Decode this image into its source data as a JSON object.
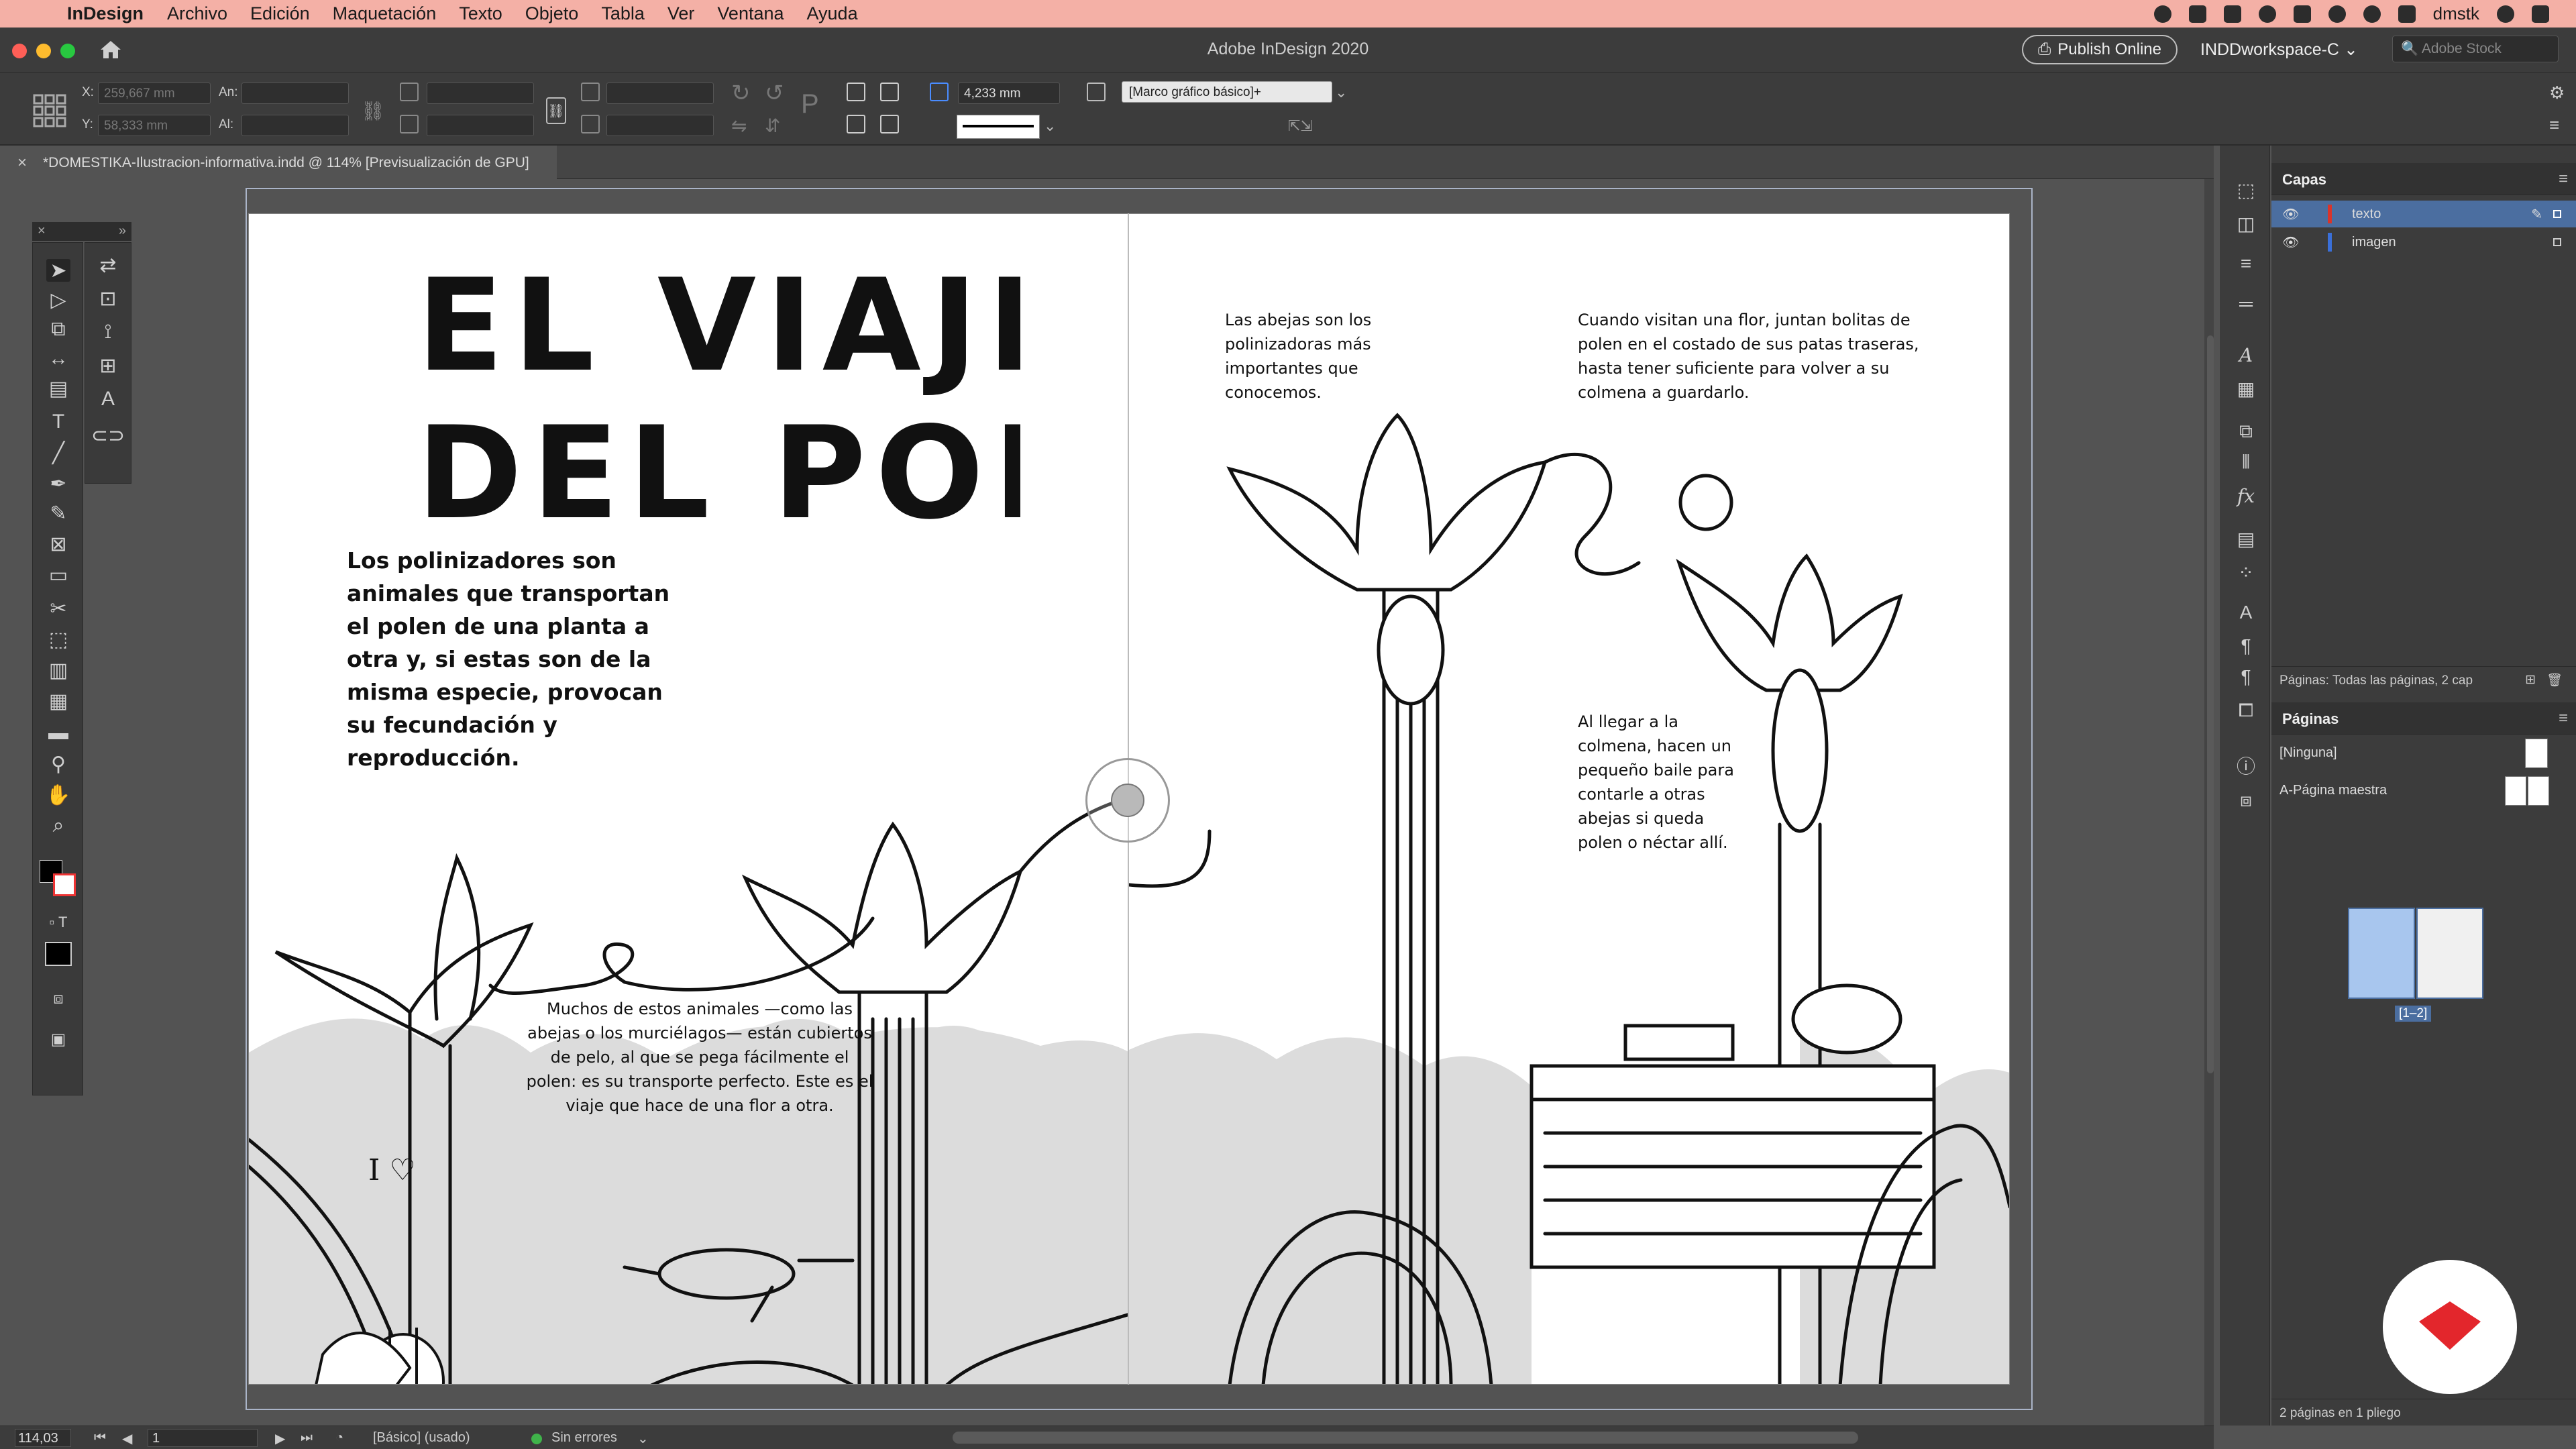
{
  "menubar": {
    "app_name": "InDesign",
    "items": [
      "Archivo",
      "Edición",
      "Maquetación",
      "Texto",
      "Objeto",
      "Tabla",
      "Ver",
      "Ventana",
      "Ayuda"
    ],
    "user": "dmstk"
  },
  "titlebar": {
    "title": "Adobe InDesign 2020",
    "publish_label": "Publish Online",
    "workspace": "INDDworkspace-C",
    "stock_placeholder": "Adobe Stock"
  },
  "control": {
    "x_label": "X:",
    "y_label": "Y:",
    "x_value": "259,667 mm",
    "y_value": "58,333 mm",
    "w_label": "An:",
    "h_label": "Al:",
    "stroke_weight": "4,233 mm",
    "object_style": "[Marco gráfico básico]+"
  },
  "document": {
    "tab_label": "*DOMESTIKA-Ilustracion-informativa.indd @ 114% [Previsualización de GPU]"
  },
  "artwork": {
    "title_line1": "EL VIAJE",
    "title_line2": "DEL POLEN",
    "intro": "Los polinizadores son animales que transportan el polen de una planta a otra y, si estas son de la misma especie, provocan su fecundación y reproducción.",
    "fur": "Muchos de estos animales —como las abejas o los murciélagos— están cubiertos de pelo, al que se pega fácilmente el polen: es su transporte perfecto. Este es el viaje que hace de una flor a otra.",
    "bees": "Las abejas son los polinizadoras más importantes que conocemos.",
    "visit": "Cuando visitan una flor, juntan bolitas de polen en el costado de sus patas traseras, hasta tener suficiente para volver a su colmena a guardarlo.",
    "hive": "Al llegar a la colmena, hacen un pequeño baile para contarle a otras abejas si queda polen o néctar allí.",
    "sign_text": "I ♡"
  },
  "layers_panel": {
    "title": "Capas",
    "layers": [
      {
        "name": "texto",
        "color": "#d9342b",
        "selected": true
      },
      {
        "name": "imagen",
        "color": "#3a6fd8",
        "selected": false
      }
    ],
    "footer": "Páginas: Todas las páginas, 2 cap"
  },
  "pages_panel": {
    "title": "Páginas",
    "none_label": "[Ninguna]",
    "master_label": "A-Página maestra",
    "spread_label": "[1–2]",
    "footer": "2 páginas en 1 pliego"
  },
  "status": {
    "zoom": "114,03",
    "page": "1",
    "style": "[Básico] (usado)",
    "preflight": "Sin errores"
  },
  "colors": {
    "menubar_bg": "#f4b0a6",
    "selection": "#4b6ea0",
    "preflight_ok": "#3fb34a",
    "domestika_red": "#e3262c"
  }
}
